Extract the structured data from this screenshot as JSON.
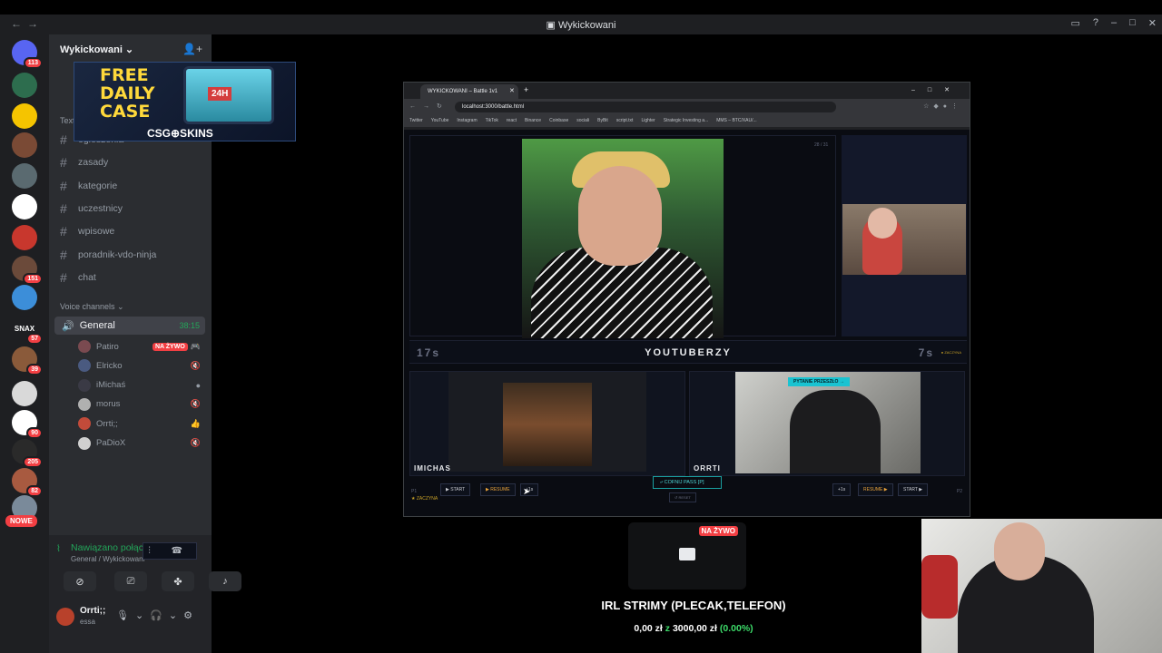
{
  "window": {
    "title": "Wykickowani"
  },
  "servers": [
    {
      "label": "",
      "badge": "113",
      "color": "#5865f2"
    },
    {
      "label": "",
      "badge": "",
      "color": "#2d6d4e"
    },
    {
      "label": "",
      "badge": "",
      "color": "#f5c400"
    },
    {
      "label": "",
      "badge": "",
      "color": "#7a4a35"
    },
    {
      "label": "",
      "badge": "",
      "color": "#5a6a70"
    },
    {
      "label": "",
      "badge": "",
      "color": "#ffffff"
    },
    {
      "label": "",
      "badge": "",
      "color": "#c8372d"
    },
    {
      "label": "",
      "badge": "151",
      "color": "#6b4a3a"
    },
    {
      "label": "",
      "badge": "",
      "color": "#3c8ed9"
    },
    {
      "label": "SNAX",
      "badge": "57",
      "color": "#1e1f22"
    },
    {
      "label": "",
      "badge": "39",
      "color": "#8a5a3a"
    },
    {
      "label": "",
      "badge": "",
      "color": "#d9d9d9"
    },
    {
      "label": "",
      "badge": "90",
      "color": "#ffffff"
    },
    {
      "label": "",
      "badge": "205",
      "color": "#2a2a2a"
    },
    {
      "label": "",
      "badge": "82",
      "color": "#a85a40"
    },
    {
      "label": "",
      "badge": "",
      "color": "#7a8a9a"
    }
  ],
  "servers_extra": {
    "nowe": "NOWE"
  },
  "guild": {
    "name": "Wykickowani ⌄"
  },
  "ad": {
    "line1": "FREE",
    "line2": "DAILY",
    "line3": "CASE",
    "tag": "24H",
    "brand": "CSG⊕SKINS"
  },
  "categories": {
    "text": "Text",
    "voice": "Voice channels ⌄"
  },
  "channels": [
    "ogłoszenia",
    "zasady",
    "kategorie",
    "uczestnicy",
    "wpisowe",
    "poradnik-vdo-ninja",
    "chat"
  ],
  "voice": {
    "channel": "General",
    "time": "38:15",
    "users": [
      {
        "name": "Patiro",
        "live": "NA ŻYWO",
        "icon": "🎮",
        "color": "#7a4a50"
      },
      {
        "name": "Elricko",
        "live": "",
        "icon": "🔇",
        "color": "#4a5a80"
      },
      {
        "name": "iMichaś",
        "live": "",
        "icon": "●",
        "color": "#3a3a45"
      },
      {
        "name": "morus",
        "live": "",
        "icon": "🔇",
        "color": "#b0b0b0"
      },
      {
        "name": "Orrti;;",
        "live": "",
        "icon": "👍",
        "color": "#c24b3a"
      },
      {
        "name": "PaDioX",
        "live": "",
        "icon": "🔇",
        "color": "#d0d0d0"
      }
    ]
  },
  "connection": {
    "status": "Nawiązano połączenie",
    "sub": "General / Wykickowani"
  },
  "me": {
    "name": "Orrti;;",
    "status": "essa"
  },
  "browser": {
    "tab": "WYKICKOWANI – Battle 1v1",
    "url": "localhost:3000/battle.html",
    "bookmarks": [
      "Twitter",
      "YouTube",
      "Instagram",
      "TikTok",
      "react",
      "Binance",
      "Coinbase",
      "sociali",
      "ByBit",
      "script.txt",
      "Lighter",
      "Strategic Investing a...",
      "MMS – BTC/XAU/..."
    ]
  },
  "battle": {
    "left_timer": "17s",
    "center": "YOUTUBERZY",
    "right_timer": "7s",
    "right_tag": "● ZACZYNA",
    "counter": "28 / 31",
    "p1": {
      "name": "IMICHAS",
      "tag": "P1",
      "starts": "★ ZACZYNA"
    },
    "p2": {
      "name": "ORRTI",
      "banner": "PYTANIE PRZESZŁO →",
      "tag": "P2"
    },
    "left_controls": [
      "▶ START",
      "▶ RESUME",
      "+1s"
    ],
    "right_controls": [
      "+1s",
      "RESUME ▶",
      "START ▶"
    ],
    "pass": "⤶ COFNIJ PASS [P]",
    "reset": "↺ RESET"
  },
  "stream": {
    "live": "NA ŻYWO",
    "title": "IRL STRIMY (PLECAK,TELEFON)",
    "amount": "0,00 zł",
    "goal": "3000,00 zł",
    "pct": "(0.00%)",
    "z": "z"
  }
}
